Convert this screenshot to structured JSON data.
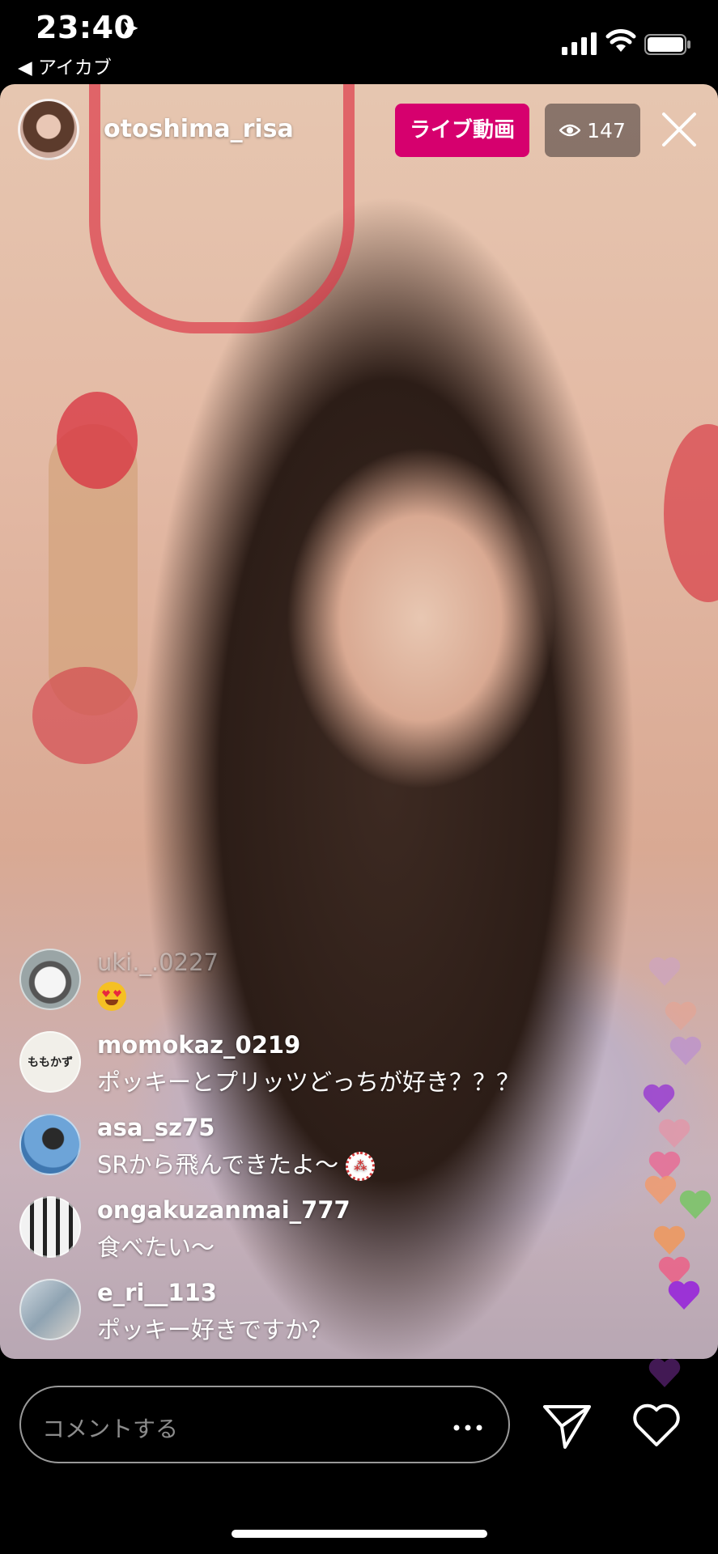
{
  "status_bar": {
    "time": "23:40",
    "back_app": "◀ アイカブ"
  },
  "header": {
    "username": "otoshima_risa",
    "live_label": "ライブ動画",
    "viewer_count": "147"
  },
  "comments": [
    {
      "user": "uki._.0227",
      "text": ""
    },
    {
      "user": "momokaz_0219",
      "text": "ポッキーとプリッツどっちが好き？？？"
    },
    {
      "user": "asa_sz75",
      "text": "SRから飛んできたよ〜"
    },
    {
      "user": "ongakuzanmai_777",
      "text": "食べたい〜"
    },
    {
      "user": "e_ri__113",
      "text": "ポッキー好きですか？"
    }
  ],
  "avatar_texts": {
    "momokaz": "ももかず"
  },
  "composer": {
    "placeholder": "コメントする"
  },
  "colors": {
    "live_badge": "#d6006e",
    "background": "#000000"
  },
  "icons": [
    "location-arrow-icon",
    "signal-icon",
    "wifi-icon",
    "battery-icon",
    "eye-icon",
    "close-icon",
    "more-icon",
    "send-icon",
    "heart-icon"
  ]
}
